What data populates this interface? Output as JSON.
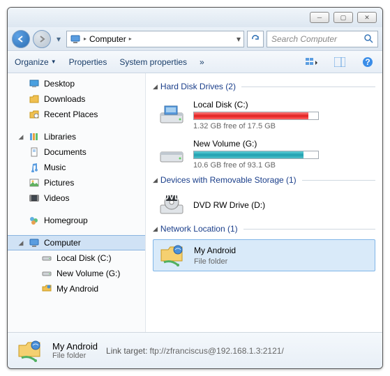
{
  "titlebar": {},
  "navbar": {
    "address_label": "Computer",
    "search_placeholder": "Search Computer"
  },
  "toolbar": {
    "organize": "Organize",
    "properties": "Properties",
    "system_properties": "System properties"
  },
  "sidebar": {
    "favorites": {
      "desktop": "Desktop",
      "downloads": "Downloads",
      "recent": "Recent Places"
    },
    "libraries": {
      "label": "Libraries",
      "documents": "Documents",
      "music": "Music",
      "pictures": "Pictures",
      "videos": "Videos"
    },
    "homegroup": "Homegroup",
    "computer": {
      "label": "Computer",
      "local_c": "Local Disk (C:)",
      "new_g": "New Volume (G:)",
      "my_android": "My Android"
    }
  },
  "main": {
    "groups": {
      "hdd": {
        "label": "Hard Disk Drives (2)"
      },
      "removable": {
        "label": "Devices with Removable Storage (1)"
      },
      "network": {
        "label": "Network Location (1)"
      }
    },
    "drives": {
      "local_c": {
        "name": "Local Disk (C:)",
        "free": "1.32 GB free of 17.5 GB",
        "fill_pct": 92
      },
      "new_g": {
        "name": "New Volume (G:)",
        "free": "10.6 GB free of 93.1 GB",
        "fill_pct": 88
      },
      "dvd": {
        "name": "DVD RW Drive (D:)"
      },
      "my_android": {
        "name": "My Android",
        "type": "File folder"
      }
    }
  },
  "details": {
    "name": "My Android",
    "type": "File folder",
    "link_label": "Link target:",
    "link_target": "ftp://zfranciscus@192.168.1.3:2121/"
  }
}
